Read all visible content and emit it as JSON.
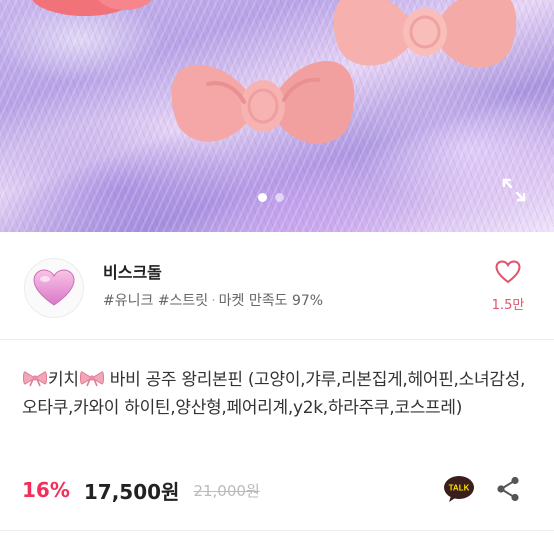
{
  "hero": {
    "image_desc": "",
    "carousel_total": 2,
    "carousel_active": 1,
    "expand_icon": "expand-icon"
  },
  "shop": {
    "name": "비스크돌",
    "tags": "#유니크 #스트릿",
    "separator": "·",
    "rating": "마켓 만족도 97%",
    "like_count": "1.5만",
    "avatar_icon": "heart-icon"
  },
  "product": {
    "title_part1": "키치",
    "title_part2": " 바비 공주 왕리본핀 (고양이,갸루,리본집게,헤어핀,소녀감성,오타쿠,카와이 하이틴,양산형,페어리계,y2k,하라주쿠,코스프레)",
    "discount": "16%",
    "price": "17,500원",
    "original_price": "21,000원",
    "talk_label": "TALK"
  },
  "colors": {
    "accent": "#f0305a",
    "like": "#e0526d",
    "talk_bg": "#3a1d1d",
    "talk_bubble": "#fae100"
  }
}
